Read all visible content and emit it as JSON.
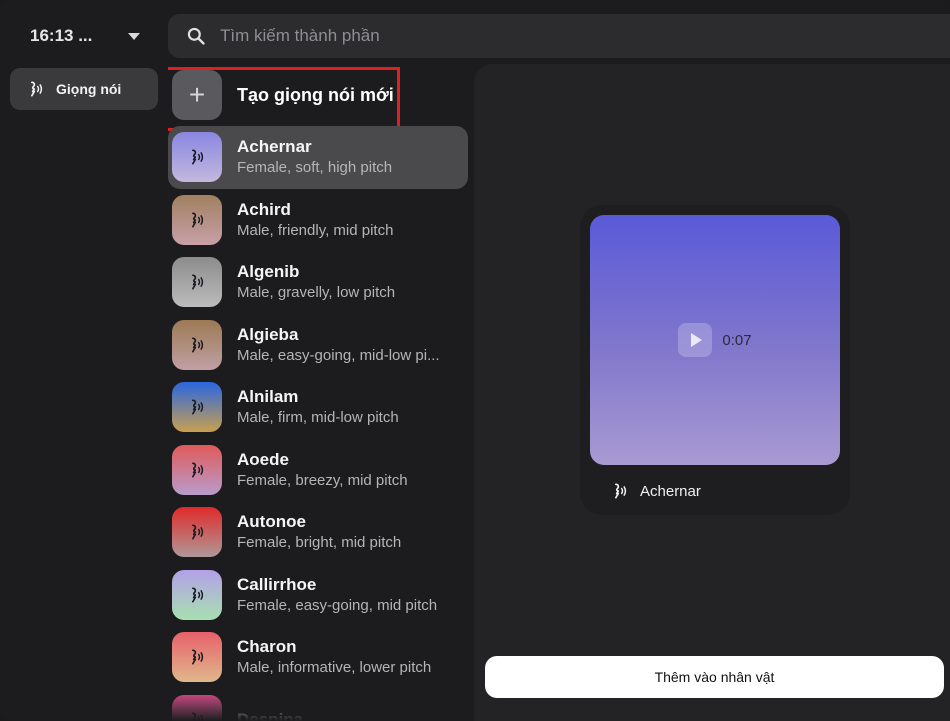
{
  "header": {
    "time_label": "16:13 ...",
    "search_placeholder": "Tìm kiếm thành phần"
  },
  "sidebar": {
    "category_label": "Giọng nói"
  },
  "create_voice_label": "Tạo giọng nói mới",
  "voices": [
    {
      "name": "Achernar",
      "desc": "Female, soft, high pitch",
      "selected": true,
      "gradient": [
        "#8a86e0",
        "#c3b8de"
      ]
    },
    {
      "name": "Achird",
      "desc": "Male, friendly, mid pitch",
      "gradient": [
        "#a08060",
        "#c8a0a8"
      ]
    },
    {
      "name": "Algenib",
      "desc": "Male, gravelly, low pitch",
      "gradient": [
        "#8c8c8c",
        "#bcbcbc"
      ]
    },
    {
      "name": "Algieba",
      "desc": "Male, easy-going, mid-low pi...",
      "gradient": [
        "#9c7a54",
        "#c0a0a4"
      ]
    },
    {
      "name": "Alnilam",
      "desc": "Male, firm, mid-low pitch",
      "gradient": [
        "#2a66e0",
        "#c8a050"
      ]
    },
    {
      "name": "Aoede",
      "desc": "Female, breezy, mid pitch",
      "gradient": [
        "#e05a5a",
        "#b89ccc"
      ]
    },
    {
      "name": "Autonoe",
      "desc": "Female, bright, mid pitch",
      "gradient": [
        "#e02a2a",
        "#b09898"
      ]
    },
    {
      "name": "Callirrhoe",
      "desc": "Female, easy-going, mid pitch",
      "gradient": [
        "#b4a0e8",
        "#a8e0b0"
      ]
    },
    {
      "name": "Charon",
      "desc": "Male, informative, lower pitch",
      "gradient": [
        "#e8606a",
        "#e0b88c"
      ]
    },
    {
      "name": "Despina",
      "desc": "",
      "gradient": [
        "#e04a8a",
        "#c080b0"
      ]
    }
  ],
  "preview": {
    "duration": "0:07",
    "voice_name": "Achernar"
  },
  "add_button_label": "Thêm vào nhân vật",
  "colors": {
    "highlight": "#e02020",
    "panel": "#232325",
    "background": "#1c1c1e"
  },
  "icons": {
    "search": "search-icon",
    "voice": "voice-icon",
    "play": "play-icon",
    "plus": "plus-icon",
    "dropdown": "chevron-down-icon"
  }
}
